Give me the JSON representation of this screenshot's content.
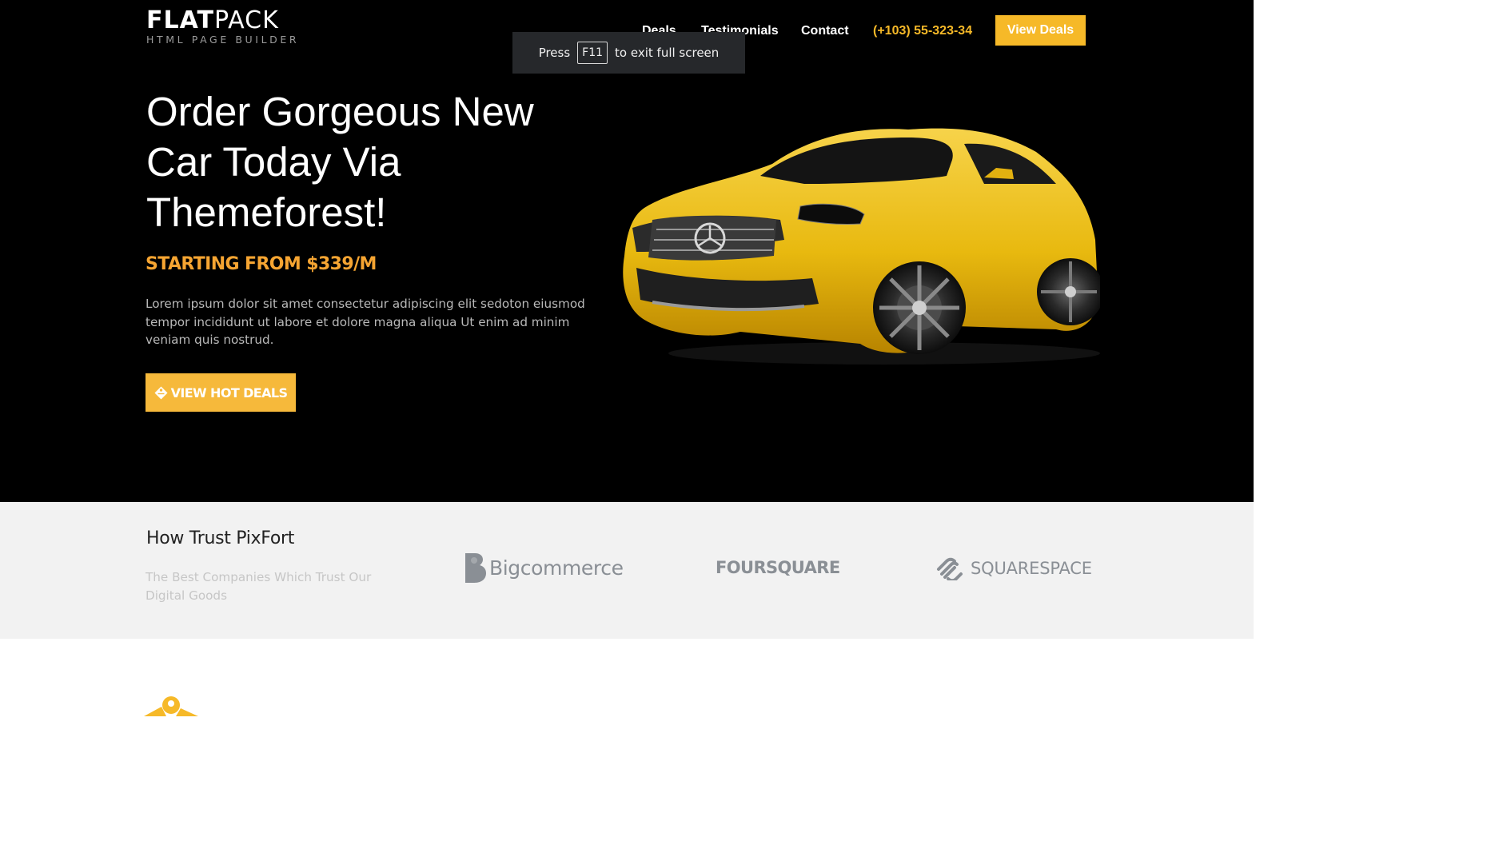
{
  "logo": {
    "title_bold": "FLAT",
    "title_light": "PACK",
    "subtitle": "HTML PAGE BUILDER"
  },
  "nav": {
    "items": [
      "Deals",
      "Testimonials",
      "Contact"
    ],
    "phone": "(+103) 55-323-34",
    "cta": "View Deals"
  },
  "fullscreen_notice": {
    "prefix": "Press",
    "key": "F11",
    "suffix": "to exit full screen"
  },
  "hero": {
    "headline": "Order Gorgeous New Car Today Via Themeforest!",
    "price": "STARTING FROM $339/M",
    "description": "Lorem ipsum dolor sit amet consectetur adipiscing elit sedoton eiusmod tempor incididunt ut labore et dolore magna aliqua Ut enim ad minim veniam quis nostrud.",
    "button": "VIEW HOT DEALS",
    "button_icon": "tag-icon",
    "image": "yellow-suv-car"
  },
  "trust": {
    "title": "How Trust PixFort",
    "subtitle": "The Best Companies Which Trust Our Digital Goods",
    "logos": [
      "Bigcommerce",
      "FOURSQUARE",
      "SQUARESPACE"
    ]
  },
  "colors": {
    "accent": "#f6b928",
    "price": "#f6a532",
    "hero_bg": "#000000",
    "trust_bg": "#f2f2f2",
    "logo_gray": "#8a8f95"
  }
}
